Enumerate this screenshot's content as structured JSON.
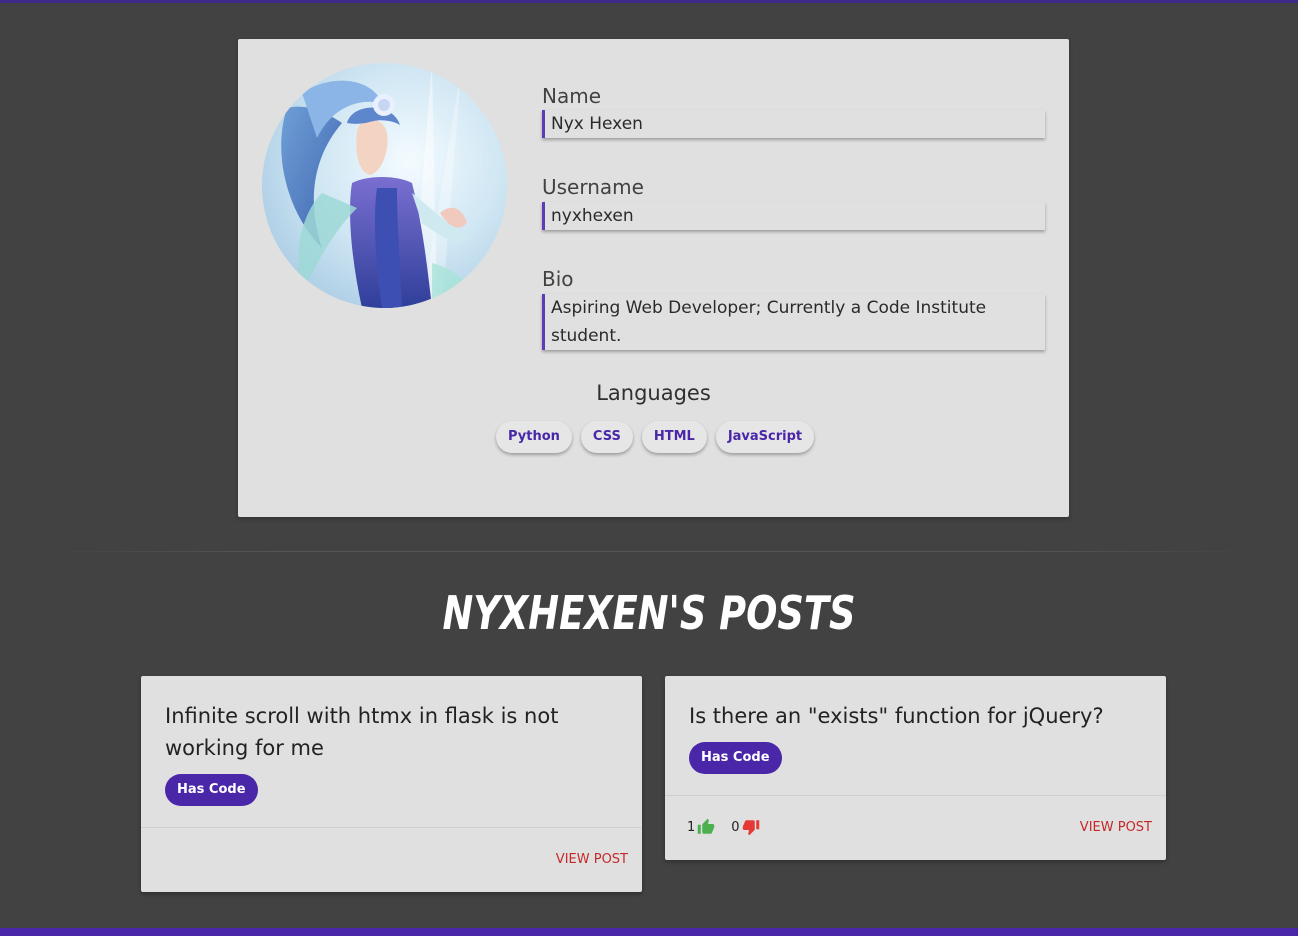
{
  "profile": {
    "name_label": "Name",
    "name_value": "Nyx Hexen",
    "username_label": "Username",
    "username_value": "nyxhexen",
    "bio_label": "Bio",
    "bio_value": "Aspiring Web Developer; Currently a Code Institute student.",
    "languages_title": "Languages",
    "languages": [
      "Python",
      "CSS",
      "HTML",
      "JavaScript"
    ]
  },
  "posts_section": {
    "title": "nyxhexen's Posts"
  },
  "posts": [
    {
      "title": "Infinite scroll with htmx in flask is not working for me",
      "badge": "Has Code",
      "view_label": "View Post"
    },
    {
      "title": "Is there an \"exists\" function for jQuery?",
      "badge": "Has Code",
      "upvotes": "1",
      "downvotes": "0",
      "view_label": "View Post"
    }
  ],
  "colors": {
    "accent": "#4a26a8",
    "background": "#424242",
    "card": "#e0e0e0",
    "link": "#c62828",
    "upvote": "#4caf50",
    "downvote": "#e53935"
  },
  "icons": [
    "thumbs-up-icon",
    "thumbs-down-icon"
  ]
}
